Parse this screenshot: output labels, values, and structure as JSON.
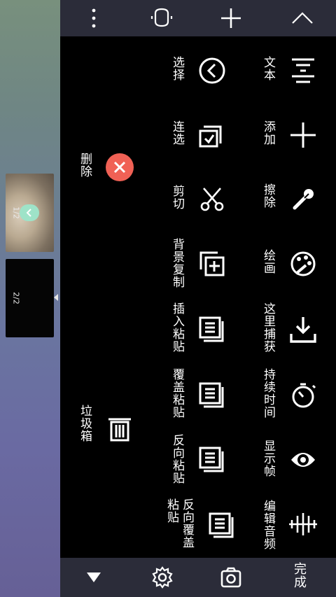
{
  "thumbnails": [
    {
      "page_label": "1/2",
      "selected": true
    },
    {
      "page_label": "2/2",
      "selected": false
    }
  ],
  "top_bar": {
    "icons": [
      "more-vert-icon",
      "voice-icon",
      "add-icon",
      "collapse-icon"
    ]
  },
  "bottom_bar": {
    "icons": [
      "expand-icon",
      "settings-icon",
      "camera-icon"
    ],
    "done_label": "完成"
  },
  "menu": {
    "column_right": [
      {
        "icon": "text-icon",
        "label": "文本"
      },
      {
        "icon": "plus-icon",
        "label": "添加"
      },
      {
        "icon": "brush-icon",
        "label": "擦除"
      },
      {
        "icon": "palette-icon",
        "label": "绘画"
      },
      {
        "icon": "download-icon",
        "label": "这里捕获"
      },
      {
        "icon": "timer-icon",
        "label": "持续时间"
      },
      {
        "icon": "eye-icon",
        "label": "显示帧"
      },
      {
        "icon": "audio-wave-icon",
        "label": "编辑音频"
      }
    ],
    "column_middle": [
      {
        "icon": "select-icon",
        "label": "选择"
      },
      {
        "icon": "multi-select-icon",
        "label": "连选"
      },
      {
        "icon": "scissors-icon",
        "label": "剪切"
      },
      {
        "icon": "copy-bg-icon",
        "label": "背景复制"
      },
      {
        "icon": "paste-icon",
        "label": "插入粘贴"
      },
      {
        "icon": "paste-icon",
        "label": "覆盖粘贴"
      },
      {
        "icon": "paste-icon",
        "label": "反向粘贴"
      },
      {
        "icon": "paste-icon",
        "label": "反向覆盖粘贴"
      }
    ],
    "delete_label": "删除",
    "trash_label": "垃圾箱"
  }
}
